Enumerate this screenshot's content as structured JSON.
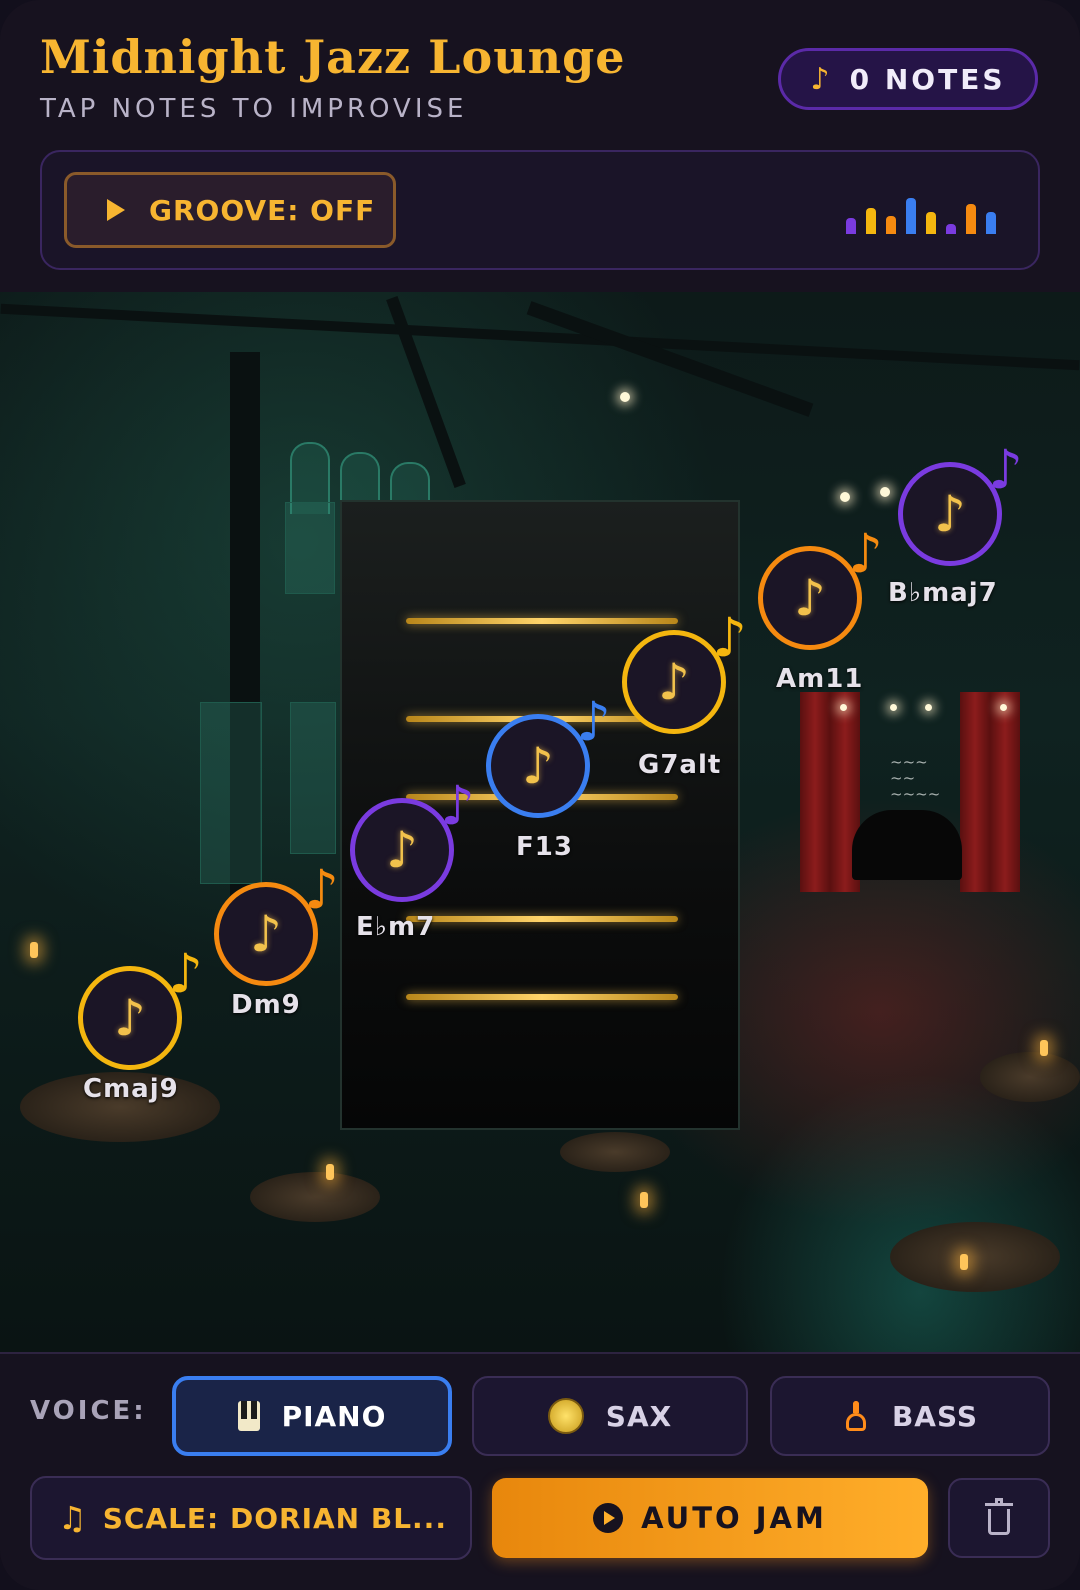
{
  "header": {
    "title": "Midnight Jazz Lounge",
    "subtitle": "TAP NOTES TO IMPROVISE",
    "notes_count": "0 NOTES",
    "groove_label": "GROOVE: OFF"
  },
  "notes": [
    {
      "chord": "Cmaj9",
      "color": "#f4b60f"
    },
    {
      "chord": "Dm9",
      "color": "#f58a10"
    },
    {
      "chord": "E♭m7",
      "color": "#7a3be0"
    },
    {
      "chord": "F13",
      "color": "#3a7ef0"
    },
    {
      "chord": "G7alt",
      "color": "#f4b60f"
    },
    {
      "chord": "Am11",
      "color": "#f58a10"
    },
    {
      "chord": "B♭maj7",
      "color": "#7a3be0"
    }
  ],
  "controls": {
    "voice_label": "VOICE:",
    "voices": [
      {
        "label": "PIANO",
        "active": true
      },
      {
        "label": "SAX",
        "active": false
      },
      {
        "label": "BASS",
        "active": false
      }
    ],
    "scale_label": "SCALE: DORIAN BL...",
    "auto_jam_label": "AUTO JAM"
  },
  "colors": {
    "accent_gold": "#f7b531",
    "accent_orange": "#f58a10",
    "accent_purple": "#7a3be0",
    "accent_blue": "#3a7ef0"
  }
}
